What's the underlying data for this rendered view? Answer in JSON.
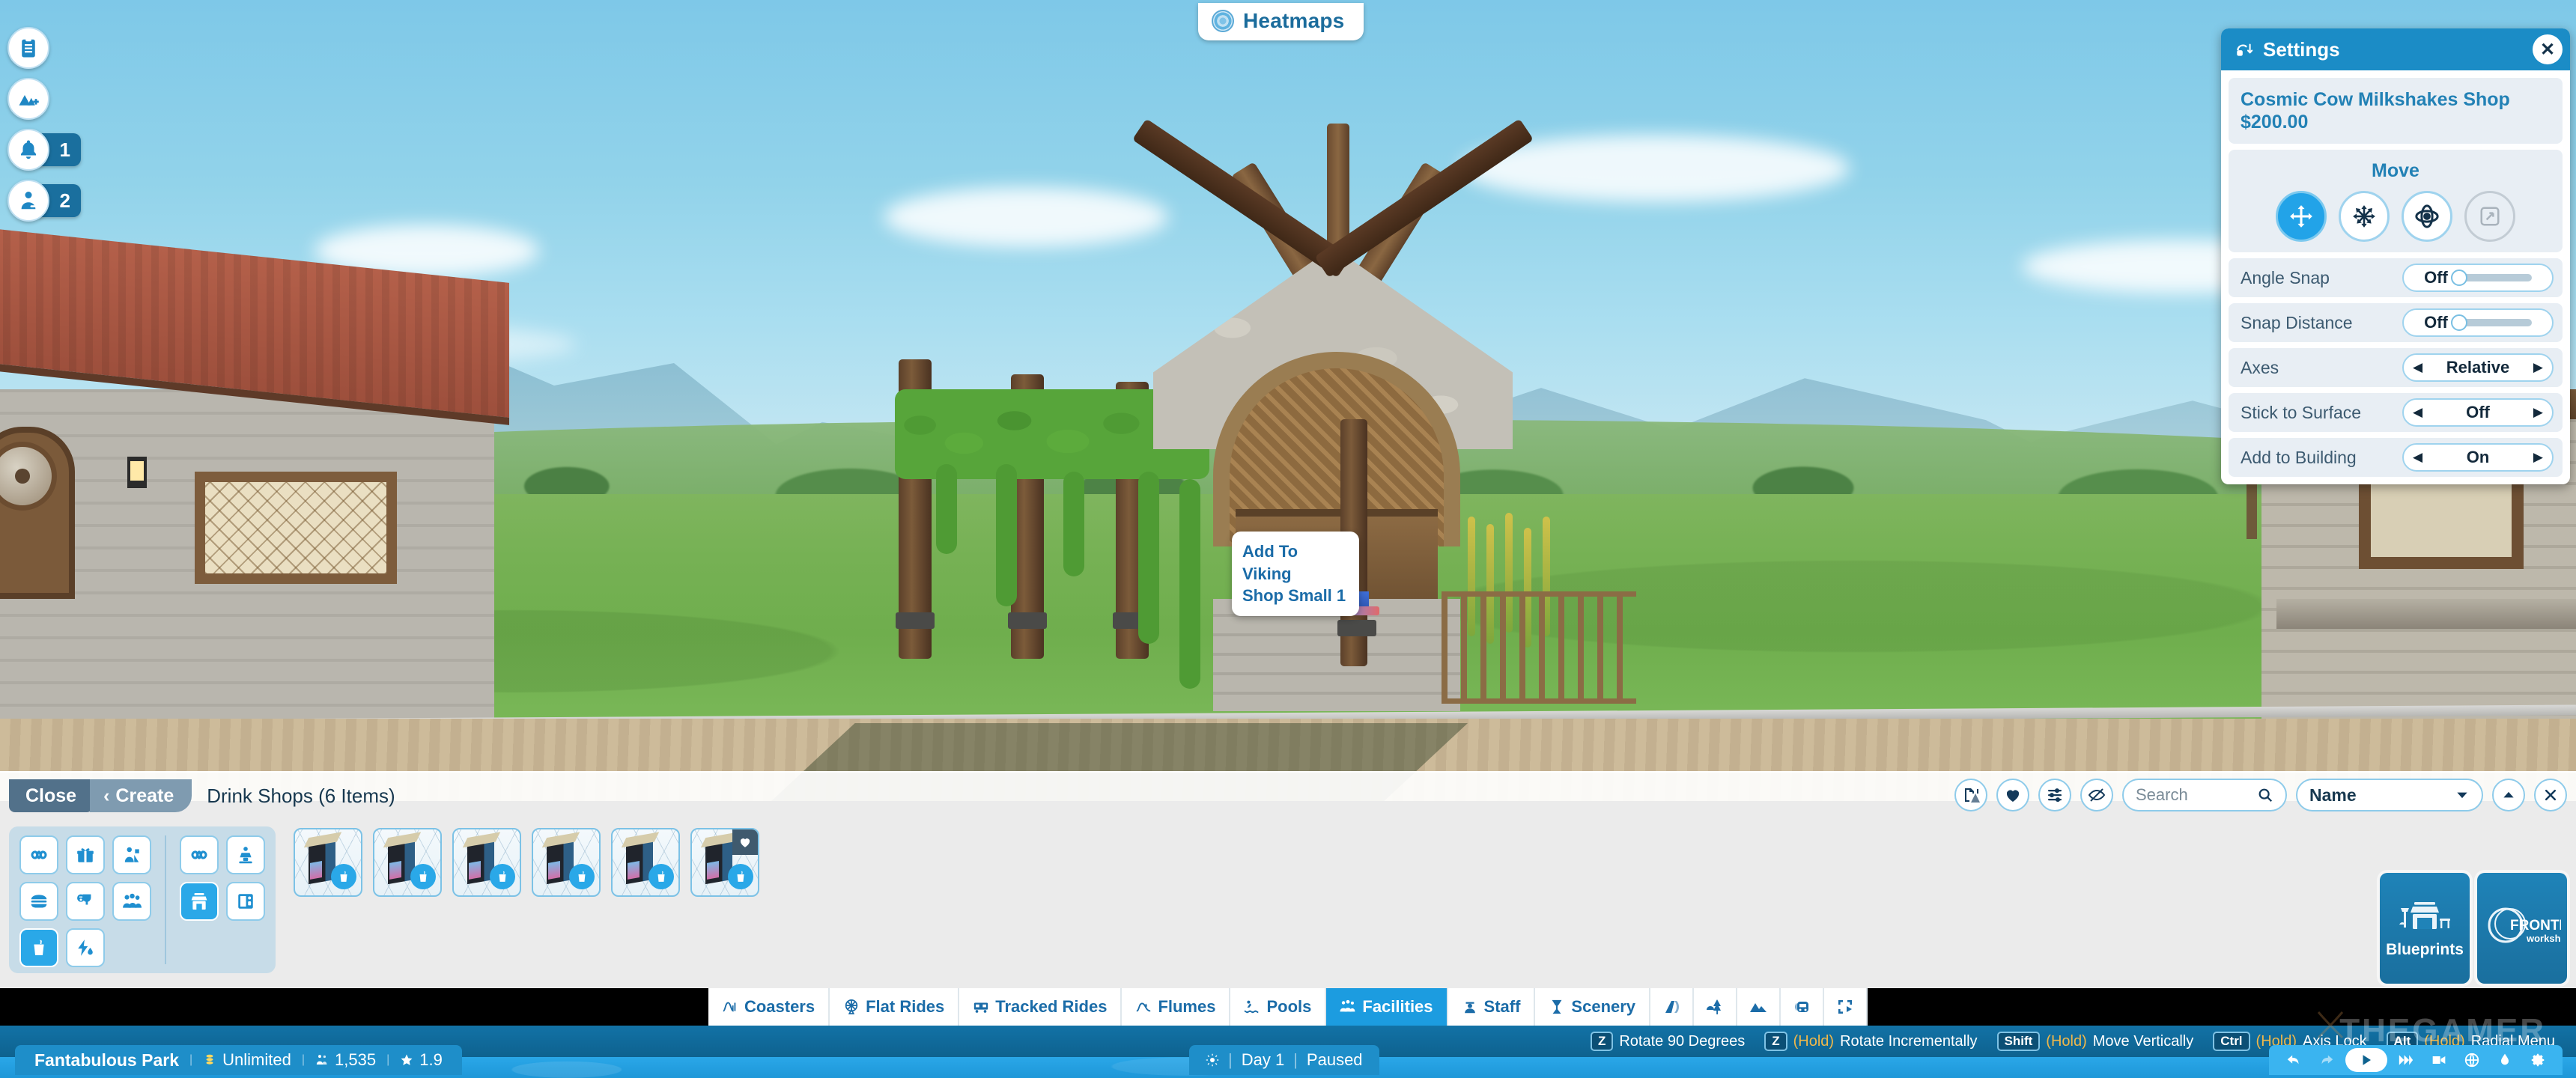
{
  "heatmaps": {
    "label": "Heatmaps",
    "icon": "heatmap-target-icon"
  },
  "left_rail": [
    {
      "name": "objectives",
      "icon": "clipboard-icon",
      "badge": null
    },
    {
      "name": "scenery-add",
      "icon": "mountain-plus-icon",
      "badge": null
    },
    {
      "name": "notifications",
      "icon": "bell-icon",
      "badge": "1"
    },
    {
      "name": "staff-alerts",
      "icon": "person-alert-icon",
      "badge": "2"
    }
  ],
  "settings": {
    "title": "Settings",
    "close_label": "✕",
    "object_name": "Cosmic Cow Milkshakes Shop",
    "object_price": "$200.00",
    "move_title": "Move",
    "move_buttons": [
      {
        "name": "translate-tool",
        "icon": "four-way-arrows-icon",
        "state": "active"
      },
      {
        "name": "free-move-tool",
        "icon": "six-way-arrows-icon",
        "state": "normal"
      },
      {
        "name": "rotate-tool",
        "icon": "orbit-rotate-icon",
        "state": "normal"
      },
      {
        "name": "scale-tool",
        "icon": "resize-icon",
        "state": "disabled"
      }
    ],
    "rows": [
      {
        "label": "Angle Snap",
        "value": "Off",
        "type": "slider"
      },
      {
        "label": "Snap Distance",
        "value": "Off",
        "type": "slider"
      },
      {
        "label": "Axes",
        "value": "Relative",
        "type": "stepper"
      },
      {
        "label": "Stick to Surface",
        "value": "Off",
        "type": "stepper"
      },
      {
        "label": "Add to Building",
        "value": "On",
        "type": "stepper"
      }
    ]
  },
  "tooltip": {
    "line1": "Add To Viking",
    "line2": "Shop Small 1"
  },
  "browser": {
    "close_label": "Close",
    "create_label": "Create",
    "create_chevron": "‹",
    "title": "Drink Shops (6 Items)",
    "search_placeholder": "Search",
    "search_value": "",
    "sort_value": "Name",
    "head_buttons": [
      {
        "name": "research-icon"
      },
      {
        "name": "favourites-heart-icon"
      },
      {
        "name": "filters-sliders-icon"
      },
      {
        "name": "hide-unavailable-icon"
      }
    ],
    "collapse_label": "⌃",
    "panel_close_label": "✕",
    "filters_left": [
      {
        "name": "all-infinite-icon",
        "on": false
      },
      {
        "name": "gift-shop-icon",
        "on": false
      },
      {
        "name": "first-aid-staff-icon",
        "on": false
      },
      {
        "name": "food-burger-icon",
        "on": false
      },
      {
        "name": "toilet-icon",
        "on": false
      },
      {
        "name": "guest-group-icon",
        "on": false
      },
      {
        "name": "drink-cup-icon",
        "on": true
      },
      {
        "name": "energy-drink-icon",
        "on": false
      }
    ],
    "filters_right": [
      {
        "name": "all-infinite-icon",
        "on": false
      },
      {
        "name": "information-kiosk-icon",
        "on": false
      },
      {
        "name": "shop-stall-icon",
        "on": true
      },
      {
        "name": "vending-machine-icon",
        "on": false
      }
    ],
    "items": [
      {
        "name": "drink-shop-1",
        "badge": "drink-cup-icon",
        "favourite": false
      },
      {
        "name": "drink-shop-2",
        "badge": "drink-cup-icon",
        "favourite": false
      },
      {
        "name": "drink-shop-3",
        "badge": "drink-cup-icon",
        "favourite": false
      },
      {
        "name": "drink-shop-4",
        "badge": "drink-cup-icon",
        "favourite": false
      },
      {
        "name": "drink-shop-5",
        "badge": "drink-cup-icon",
        "favourite": false
      },
      {
        "name": "drink-shop-6",
        "badge": "drink-cup-icon",
        "favourite": true
      }
    ],
    "blueprints_label": "Blueprints",
    "frontier_label_1": "FRONTIER",
    "frontier_label_2": "workshop"
  },
  "tabs": [
    {
      "label": "Coasters",
      "icon": "coaster-icon",
      "active": false
    },
    {
      "label": "Flat Rides",
      "icon": "ferris-wheel-icon",
      "active": false
    },
    {
      "label": "Tracked Rides",
      "icon": "train-icon",
      "active": false
    },
    {
      "label": "Flumes",
      "icon": "flume-icon",
      "active": false
    },
    {
      "label": "Pools",
      "icon": "pool-icon",
      "active": false
    },
    {
      "label": "Facilities",
      "icon": "facilities-icon",
      "active": true
    },
    {
      "label": "Staff",
      "icon": "staff-icon",
      "active": false
    },
    {
      "label": "Scenery",
      "icon": "scenery-icon",
      "active": false
    },
    {
      "label": "",
      "icon": "paths-icon",
      "active": false
    },
    {
      "label": "",
      "icon": "trees-icon",
      "active": false
    },
    {
      "label": "",
      "icon": "terrain-icon",
      "active": false
    },
    {
      "label": "",
      "icon": "transport-icon",
      "active": false
    },
    {
      "label": "",
      "icon": "triggers-icon",
      "active": false
    }
  ],
  "hotkeys": [
    {
      "key": "Z",
      "hold": "",
      "label": "Rotate 90 Degrees"
    },
    {
      "key": "Z",
      "hold": "(Hold)",
      "label": "Rotate Incrementally"
    },
    {
      "key": "Shift",
      "hold": "(Hold)",
      "label": "Move Vertically"
    },
    {
      "key": "Ctrl",
      "hold": "(Hold)",
      "label": "Axis Lock"
    },
    {
      "key": "Alt",
      "hold": "(Hold)",
      "label": "Radial Menu"
    }
  ],
  "status": {
    "park_name": "Fantabulous Park",
    "money": "Unlimited",
    "guests": "1,535",
    "rating": "1.9",
    "day": "Day 1",
    "state": "Paused",
    "playback": [
      {
        "name": "undo-button",
        "icon": "undo-arrow-icon"
      },
      {
        "name": "redo-button",
        "icon": "redo-arrow-icon"
      },
      {
        "name": "play-button",
        "icon": "play-triangle-icon"
      },
      {
        "name": "fast-forward-button",
        "icon": "fast-forward-icon"
      },
      {
        "name": "camera-button",
        "icon": "camera-icon"
      },
      {
        "name": "globe-button",
        "icon": "globe-icon"
      },
      {
        "name": "weather-button",
        "icon": "weather-icon"
      },
      {
        "name": "settings-gear-button",
        "icon": "gear-icon"
      }
    ]
  },
  "watermark": {
    "text": "THEGAMER"
  }
}
